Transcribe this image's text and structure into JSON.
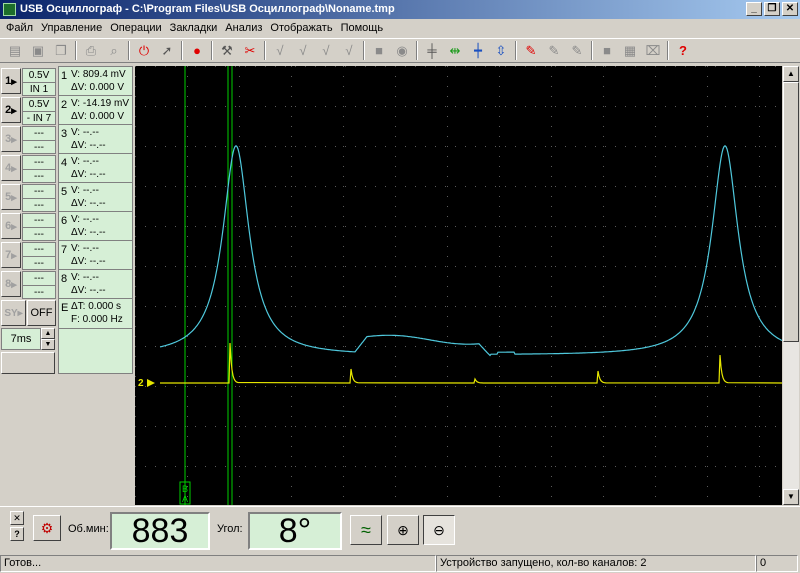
{
  "window": {
    "title": "USB Осциллограф - C:\\Program Files\\USB Осциллограф\\Noname.tmp",
    "minimize": "_",
    "restore": "❐",
    "close": "✕"
  },
  "menu": [
    "Файл",
    "Управление",
    "Операции",
    "Закладки",
    "Анализ",
    "Отображать",
    "Помощь"
  ],
  "toolbar_icons": [
    "open-icon",
    "save-icon",
    "copy-icon",
    "print-icon",
    "print-preview-icon",
    "stop-icon",
    "auto-icon",
    "record-icon",
    "probe-icon",
    "tools-icon",
    "check-icon",
    "check-v-icon",
    "check-multi-icon",
    "check-plus-icon",
    "square-icon",
    "disk-icon",
    "cursor-h-icon",
    "cursor-move-icon",
    "cursor-cross-icon",
    "cursor-y-icon",
    "trace-a-icon",
    "trace-b-icon",
    "trace-c-icon",
    "stop-square-icon",
    "grid-icon",
    "clear-icon",
    "help-icon"
  ],
  "channels": [
    {
      "num": "1",
      "volts": "0.5V",
      "input": "IN 1",
      "active": true
    },
    {
      "num": "2",
      "volts": "0.5V",
      "input": "- IN 7",
      "active": true
    },
    {
      "num": "3",
      "volts": "---",
      "input": "---",
      "active": false
    },
    {
      "num": "4",
      "volts": "---",
      "input": "---",
      "active": false
    },
    {
      "num": "5",
      "volts": "---",
      "input": "---",
      "active": false
    },
    {
      "num": "6",
      "volts": "---",
      "input": "---",
      "active": false
    },
    {
      "num": "7",
      "volts": "---",
      "input": "---",
      "active": false
    },
    {
      "num": "8",
      "volts": "---",
      "input": "---",
      "active": false
    }
  ],
  "sync": {
    "label": "SY",
    "value": "OFF"
  },
  "timebase": {
    "value": "7ms"
  },
  "measurements": [
    {
      "num": "1",
      "v": "V: 809.4 mV",
      "dv": "ΔV: 0.000 V"
    },
    {
      "num": "2",
      "v": "V: -14.19 mV",
      "dv": "ΔV: 0.000 V"
    },
    {
      "num": "3",
      "v": "V:      --.--",
      "dv": "ΔV:     --.--"
    },
    {
      "num": "4",
      "v": "V:      --.--",
      "dv": "ΔV:     --.--"
    },
    {
      "num": "5",
      "v": "V:      --.--",
      "dv": "ΔV:     --.--"
    },
    {
      "num": "6",
      "v": "V:      --.--",
      "dv": "ΔV:     --.--"
    },
    {
      "num": "7",
      "v": "V:      --.--",
      "dv": "ΔV:     --.--"
    },
    {
      "num": "8",
      "v": "V:      --.--",
      "dv": "ΔV:     --.--"
    }
  ],
  "time_meas": {
    "label": "E",
    "t": "ΔT:    0.000 s",
    "f": "F:  0.000 Hz"
  },
  "scope": {
    "marker_ch2": "2",
    "cursor_a": "A",
    "cursor_b": "B",
    "ch1_color": "#4fc8dc",
    "ch2_color": "#e6e600",
    "cursor_color": "#00d000",
    "grid_color": "#5a5a5a"
  },
  "bottom": {
    "close": "✕",
    "help": "?",
    "rpm_label": "Об.мин:",
    "rpm_value": "883",
    "angle_label": "Угол:",
    "angle_value": "8°"
  },
  "status": {
    "left": "Готов...",
    "middle": "Устройство запущено, кол-во каналов: 2",
    "right": "0"
  }
}
